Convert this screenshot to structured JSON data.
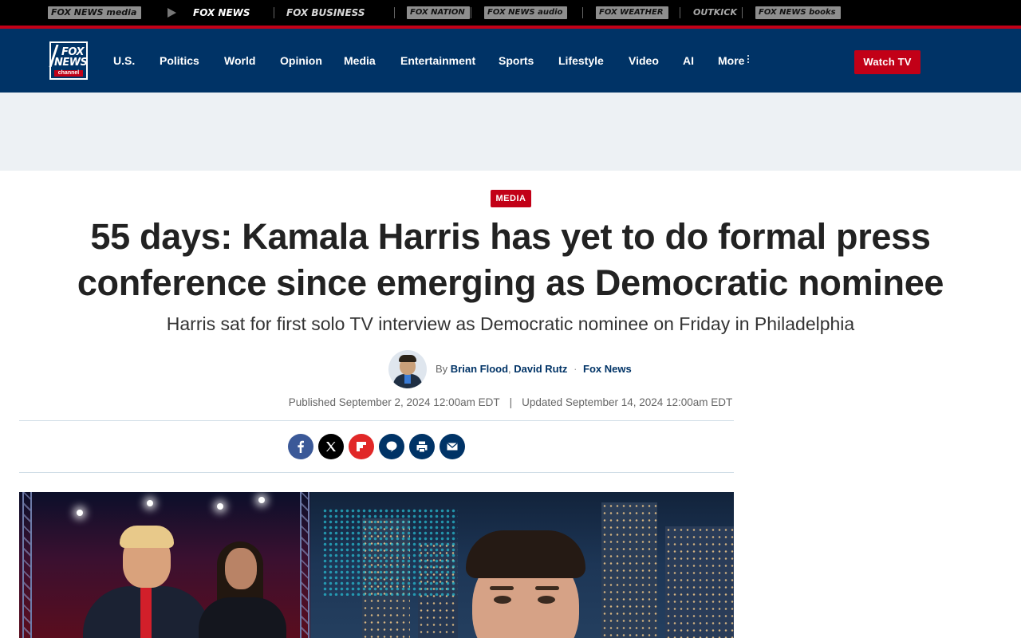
{
  "network_bar": {
    "items": [
      {
        "label": "FOX NEWS media",
        "icon": "fox-news-media-logo"
      },
      {
        "label": "FOX NEWS",
        "icon": "fox-news-logo",
        "active": true
      },
      {
        "label": "FOX BUSINESS",
        "icon": "fox-business-logo"
      },
      {
        "label": "FOX NATION",
        "icon": "fox-nation-logo"
      },
      {
        "label": "FOX NEWS audio",
        "icon": "fox-news-audio-logo"
      },
      {
        "label": "FOX WEATHER",
        "icon": "fox-weather-logo"
      },
      {
        "label": "OUTKICK",
        "icon": "outkick-logo"
      },
      {
        "label": "FOX NEWS books",
        "icon": "fox-news-books-logo"
      }
    ],
    "accent_color": "#c20017"
  },
  "header": {
    "logo": {
      "line1": "FOX",
      "line2": "NEWS",
      "line3": "channel"
    },
    "nav": [
      {
        "label": "U.S."
      },
      {
        "label": "Politics"
      },
      {
        "label": "World"
      },
      {
        "label": "Opinion"
      },
      {
        "label": "Media"
      },
      {
        "label": "Entertainment"
      },
      {
        "label": "Sports"
      },
      {
        "label": "Lifestyle"
      },
      {
        "label": "Video"
      },
      {
        "label": "AI"
      },
      {
        "label": "More"
      }
    ],
    "watch_tv_label": "Watch TV",
    "background_color": "#003366"
  },
  "article": {
    "category": "MEDIA",
    "headline": "55 days: Kamala Harris has yet to do formal press conference since emerging as Democratic nominee",
    "subheadline": "Harris sat for first solo TV interview as Democratic nominee on Friday in Philadelphia",
    "byline": {
      "prefix": "By",
      "authors": [
        "Brian Flood",
        "David Rutz"
      ],
      "separator": ",",
      "dot": "·",
      "source": "Fox News"
    },
    "published": "Published September 2, 2024 12:00am EDT",
    "pipe": "|",
    "updated": "Updated September 14, 2024 12:00am EDT",
    "share": [
      {
        "icon": "facebook-icon",
        "color": "#3b5998"
      },
      {
        "icon": "x-twitter-icon",
        "color": "#000000"
      },
      {
        "icon": "flipboard-icon",
        "color": "#e12828"
      },
      {
        "icon": "comments-icon",
        "color": "#003366"
      },
      {
        "icon": "print-icon",
        "color": "#003366"
      },
      {
        "icon": "email-icon",
        "color": "#003366"
      }
    ]
  }
}
